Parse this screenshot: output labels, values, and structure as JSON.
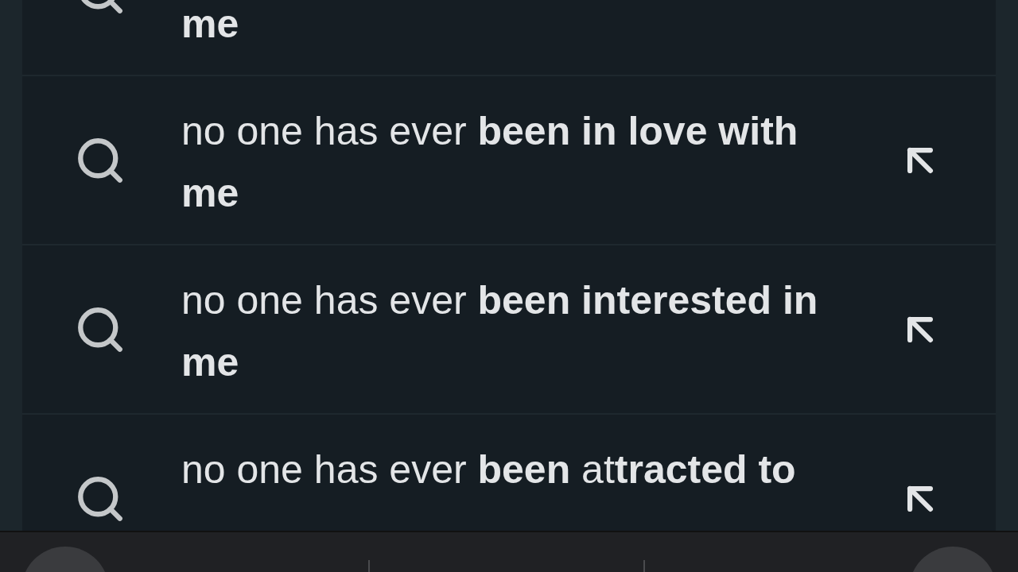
{
  "suggestions": [
    {
      "text": "**me**"
    },
    {
      "text": "no one has ever **been in love with me**"
    },
    {
      "text": "no one has ever **been interested in me**"
    },
    {
      "text": "no one has ever **been** at**tracted to**"
    }
  ]
}
